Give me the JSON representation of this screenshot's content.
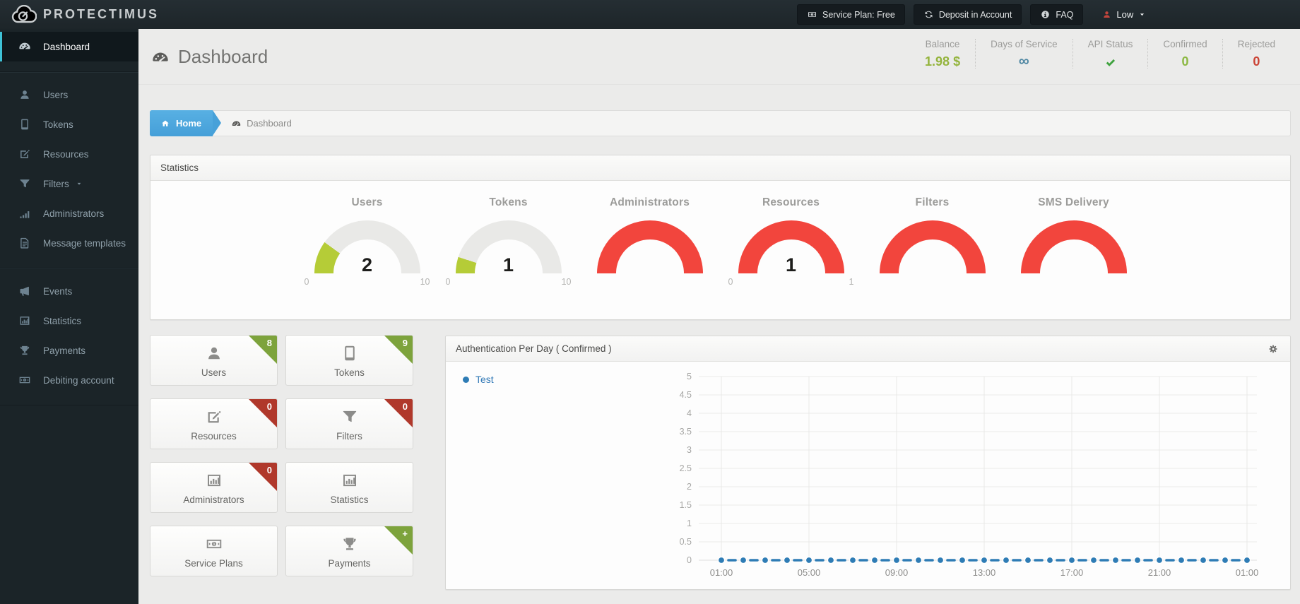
{
  "topbar": {
    "logo_text": "PROTECTIMUS",
    "buttons": [
      {
        "name": "service-plan",
        "icon": "money-icon",
        "label": "Service Plan: Free"
      },
      {
        "name": "deposit",
        "icon": "refresh-icon",
        "label": "Deposit in Account"
      },
      {
        "name": "faq",
        "icon": "info-icon",
        "label": "FAQ"
      }
    ],
    "account": {
      "label": "Low",
      "icon": "person-icon",
      "icon_color": "#c2453c"
    }
  },
  "sidebar": {
    "sections": [
      {
        "items": [
          {
            "label": "Dashboard",
            "icon": "dashboard-icon",
            "active": true
          }
        ]
      },
      {
        "items": [
          {
            "label": "Users",
            "icon": "users-icon"
          },
          {
            "label": "Tokens",
            "icon": "tokens-icon"
          },
          {
            "label": "Resources",
            "icon": "resources-icon"
          },
          {
            "label": "Filters",
            "icon": "filters-icon",
            "caret": true
          },
          {
            "label": "Administrators",
            "icon": "signal-bars-icon"
          },
          {
            "label": "Message templates",
            "icon": "document-icon"
          }
        ]
      },
      {
        "items": [
          {
            "label": "Events",
            "icon": "megaphone-icon"
          },
          {
            "label": "Statistics",
            "icon": "bar-chart-icon"
          },
          {
            "label": "Payments",
            "icon": "trophy-icon"
          },
          {
            "label": "Debiting account",
            "icon": "banknote-icon"
          }
        ]
      }
    ]
  },
  "header": {
    "title": "Dashboard",
    "stats": [
      {
        "label": "Balance",
        "value": "1.98 $",
        "color": "#94b43d"
      },
      {
        "label": "Days of Service",
        "value": "∞",
        "color": "#4f87a3"
      },
      {
        "label": "API Status",
        "value": "✔",
        "type": "check",
        "color": "#3ea23e"
      },
      {
        "label": "Confirmed",
        "value": "0",
        "color": "#8cb842"
      },
      {
        "label": "Rejected",
        "value": "0",
        "color": "#cb4335"
      }
    ]
  },
  "breadcrumb": {
    "home": "Home",
    "current": "Dashboard"
  },
  "statistics_panel": {
    "title": "Statistics",
    "gauges": [
      {
        "title": "Users",
        "value": "2",
        "min": "0",
        "max": "10",
        "fraction": 0.2,
        "color": "#b5cc37"
      },
      {
        "title": "Tokens",
        "value": "1",
        "min": "0",
        "max": "10",
        "fraction": 0.1,
        "color": "#b5cc37"
      },
      {
        "title": "Administrators",
        "value": "",
        "min": "",
        "max": "",
        "fraction": 1,
        "color": "#f2453d"
      },
      {
        "title": "Resources",
        "value": "1",
        "min": "0",
        "max": "1",
        "fraction": 1,
        "color": "#f2453d"
      },
      {
        "title": "Filters",
        "value": "",
        "min": "",
        "max": "",
        "fraction": 1,
        "color": "#f2453d"
      },
      {
        "title": "SMS Delivery",
        "value": "",
        "min": "",
        "max": "",
        "fraction": 1,
        "color": "#f2453d"
      }
    ]
  },
  "tiles": [
    {
      "label": "Users",
      "icon": "users-icon",
      "badge": "8",
      "badge_color": "#7da33c"
    },
    {
      "label": "Tokens",
      "icon": "tokens-icon",
      "badge": "9",
      "badge_color": "#7da33c"
    },
    {
      "label": "Resources",
      "icon": "resources-icon",
      "badge": "0",
      "badge_color": "#b0382b"
    },
    {
      "label": "Filters",
      "icon": "filters-icon",
      "badge": "0",
      "badge_color": "#b0382b"
    },
    {
      "label": "Administrators",
      "icon": "bar-chart-icon",
      "badge": "0",
      "badge_color": "#b0382b"
    },
    {
      "label": "Statistics",
      "icon": "bar-chart-icon",
      "badge": "",
      "badge_color": ""
    },
    {
      "label": "Service Plans",
      "icon": "banknote-icon",
      "badge": "",
      "badge_color": ""
    },
    {
      "label": "Payments",
      "icon": "trophy-icon",
      "badge": "+",
      "badge_color": "#7da33c"
    }
  ],
  "chart_panel": {
    "title": "Authentication Per Day ( Confirmed )",
    "chart_data": {
      "type": "line",
      "title": "Authentication Per Day ( Confirmed )",
      "legend": [
        {
          "name": "Test",
          "color": "#337ab7"
        }
      ],
      "legend_position": "top-left",
      "x": [
        "01:00",
        "02:00",
        "03:00",
        "04:00",
        "05:00",
        "06:00",
        "07:00",
        "08:00",
        "09:00",
        "10:00",
        "11:00",
        "12:00",
        "13:00",
        "14:00",
        "15:00",
        "16:00",
        "17:00",
        "18:00",
        "19:00",
        "20:00",
        "21:00",
        "22:00",
        "23:00",
        "00:00",
        "01:00"
      ],
      "x_tick_labels": [
        "01:00",
        "05:00",
        "09:00",
        "13:00",
        "17:00",
        "21:00",
        "01:00"
      ],
      "series": [
        {
          "name": "Test",
          "color": "#2e7cb5",
          "style": "dashed-with-markers",
          "values": [
            0,
            0,
            0,
            0,
            0,
            0,
            0,
            0,
            0,
            0,
            0,
            0,
            0,
            0,
            0,
            0,
            0,
            0,
            0,
            0,
            0,
            0,
            0,
            0,
            0
          ]
        }
      ],
      "ylim": [
        0,
        5
      ],
      "ytick_step": 0.5,
      "grid": true
    }
  }
}
